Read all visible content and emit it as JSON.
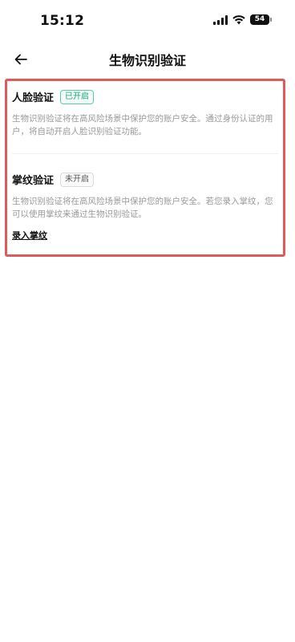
{
  "status_bar": {
    "time": "15:12",
    "battery": "54"
  },
  "header": {
    "title": "生物识别验证"
  },
  "face": {
    "title": "人脸验证",
    "badge": "已开启",
    "description": "生物识别验证将在高风险场景中保护您的账户安全。通过身份认证的用户，将自动开启人脸识别验证功能。"
  },
  "palm": {
    "title": "掌纹验证",
    "badge": "未开启",
    "description": "生物识别验证将在高风险场景中保护您的账户安全。若您录入掌纹，您可以使用掌纹来通过生物识别验证。",
    "link": "录入掌纹"
  },
  "colors": {
    "highlight_border": "#e05a5a",
    "badge_on": "#1aa67a",
    "description_text": "#999999"
  }
}
